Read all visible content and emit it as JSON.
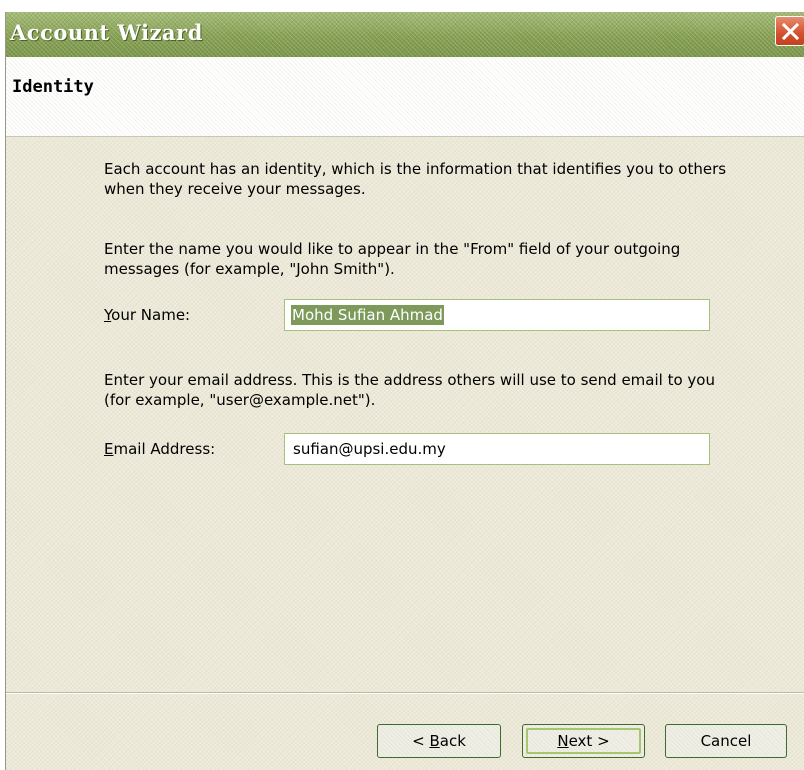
{
  "window": {
    "title": "Account Wizard"
  },
  "page": {
    "header_title": "Identity",
    "intro_text": "Each account has an identity, which is the information that identifies you to others when they receive your messages.",
    "name_instruction": "Enter the name you would like to appear in the \"From\" field of your outgoing messages (for example, \"John Smith\").",
    "email_instruction": "Enter your email address. This is the address others will use to send email to you (for example, \"user@example.net\")."
  },
  "form": {
    "name_label_accel": "Y",
    "name_label_rest": "our Name:",
    "name_value": "Mohd Sufian Ahmad",
    "email_label_accel": "E",
    "email_label_rest": "mail Address:",
    "email_value": "sufian@upsi.edu.my"
  },
  "buttons": {
    "back_prefix": "< ",
    "back_accel": "B",
    "back_rest": "ack",
    "next_accel": "N",
    "next_rest": "ext >",
    "cancel": "Cancel"
  },
  "icons": {
    "close": "close-icon"
  },
  "colors": {
    "titlebar": "#86a052",
    "dialog_bg": "#ece9d8",
    "close_button": "#d2512d",
    "selection": "#7d9a5a"
  }
}
